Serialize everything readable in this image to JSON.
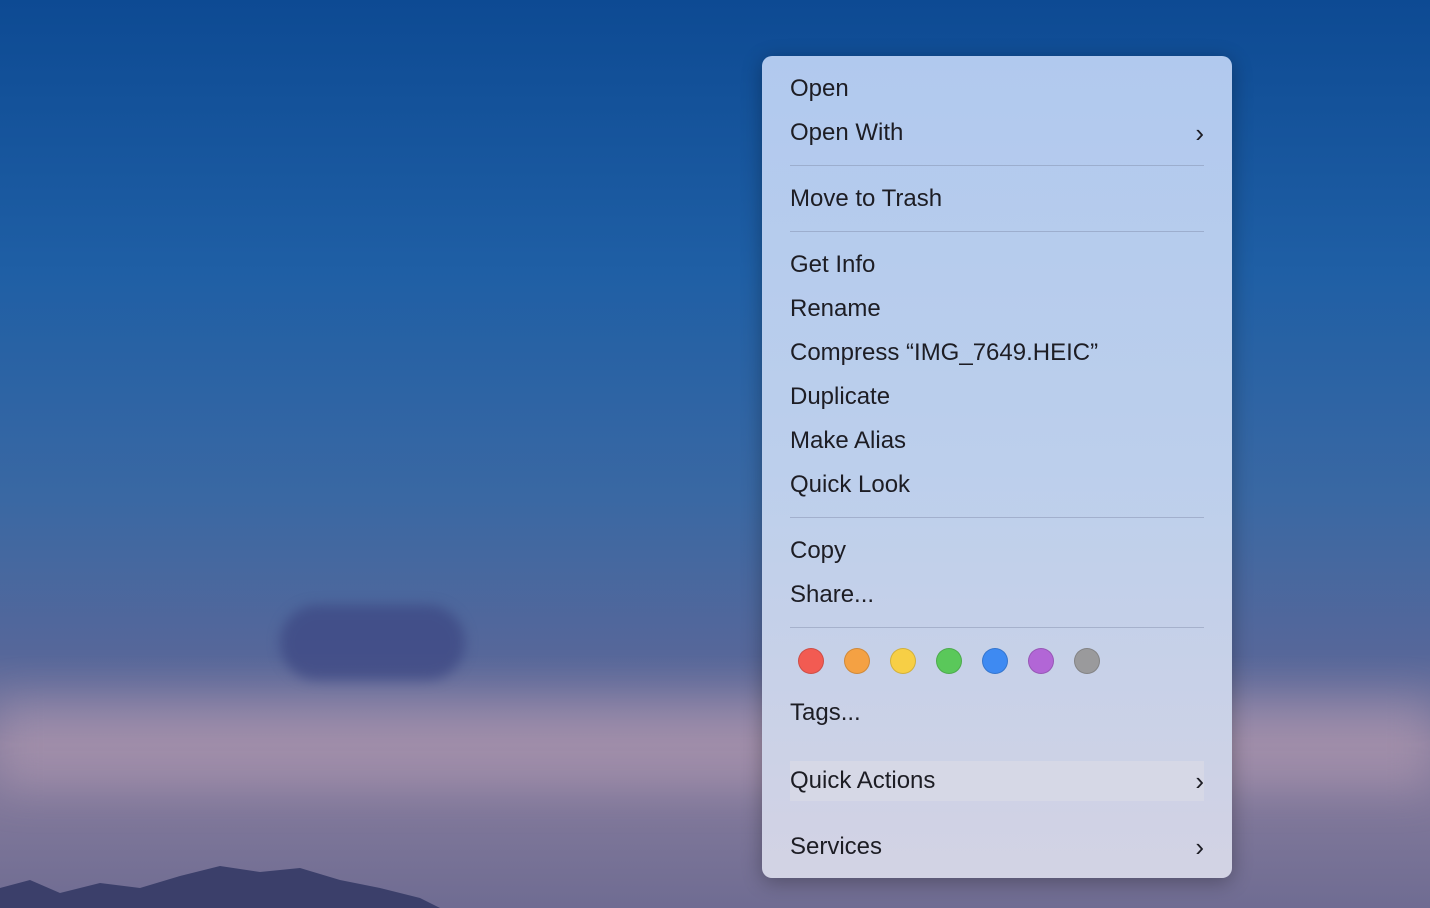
{
  "menu": {
    "items": [
      {
        "label": "Open"
      },
      {
        "label": "Open With",
        "submenu": true
      },
      {
        "label": "Move to Trash"
      },
      {
        "label": "Get Info"
      },
      {
        "label": "Rename"
      },
      {
        "label": "Compress “IMG_7649.HEIC”"
      },
      {
        "label": "Duplicate"
      },
      {
        "label": "Make Alias"
      },
      {
        "label": "Quick Look"
      },
      {
        "label": "Copy"
      },
      {
        "label": "Share..."
      },
      {
        "label": "Tags..."
      },
      {
        "label": "Quick Actions",
        "submenu": true,
        "highlighted": true
      },
      {
        "label": "Services",
        "submenu": true
      }
    ],
    "chevron": "›",
    "tag_colors": [
      {
        "name": "red",
        "color": "#f25b52"
      },
      {
        "name": "orange",
        "color": "#f4a143"
      },
      {
        "name": "yellow",
        "color": "#f7cf45"
      },
      {
        "name": "green",
        "color": "#5ac85a"
      },
      {
        "name": "blue",
        "color": "#3e8af2"
      },
      {
        "name": "purple",
        "color": "#b266d6"
      },
      {
        "name": "gray",
        "color": "#9a9a9c"
      }
    ],
    "highlight_color": "#f5334a"
  }
}
